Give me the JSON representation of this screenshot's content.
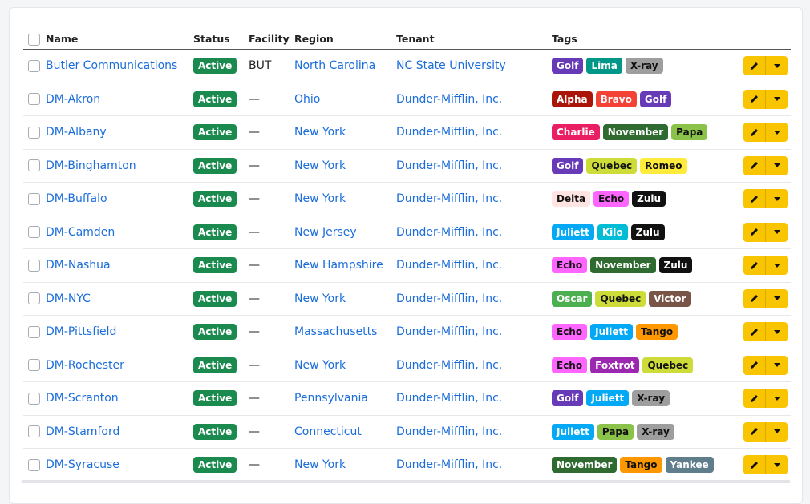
{
  "columns": {
    "name": "Name",
    "status": "Status",
    "facility": "Facility",
    "region": "Region",
    "tenant": "Tenant",
    "tags": "Tags"
  },
  "tag_colors": {
    "Golf": {
      "bg": "#673ab7",
      "fg": "#ffffff"
    },
    "Lima": {
      "bg": "#009688",
      "fg": "#ffffff"
    },
    "X-ray": {
      "bg": "#9e9e9e",
      "fg": "#111111"
    },
    "Alpha": {
      "bg": "#aa1409",
      "fg": "#ffffff"
    },
    "Bravo": {
      "bg": "#f44336",
      "fg": "#ffffff"
    },
    "Charlie": {
      "bg": "#e91e63",
      "fg": "#ffffff"
    },
    "November": {
      "bg": "#2f6a31",
      "fg": "#ffffff"
    },
    "Papa": {
      "bg": "#8bc34a",
      "fg": "#111111"
    },
    "Quebec": {
      "bg": "#cddc39",
      "fg": "#111111"
    },
    "Romeo": {
      "bg": "#ffeb3b",
      "fg": "#111111"
    },
    "Delta": {
      "bg": "#ffe4e1",
      "fg": "#111111"
    },
    "Echo": {
      "bg": "#ff66ff",
      "fg": "#111111"
    },
    "Zulu": {
      "bg": "#111111",
      "fg": "#ffffff"
    },
    "Juliett": {
      "bg": "#03a9f4",
      "fg": "#ffffff"
    },
    "Kilo": {
      "bg": "#00bcd4",
      "fg": "#ffffff"
    },
    "Oscar": {
      "bg": "#4caf50",
      "fg": "#ffffff"
    },
    "Victor": {
      "bg": "#795548",
      "fg": "#ffffff"
    },
    "Tango": {
      "bg": "#ff9800",
      "fg": "#111111"
    },
    "Foxtrot": {
      "bg": "#9c27b0",
      "fg": "#ffffff"
    },
    "Yankee": {
      "bg": "#607d8b",
      "fg": "#ffffff"
    }
  },
  "rows": [
    {
      "name": "Butler Communications",
      "status": "Active",
      "facility": "BUT",
      "region": "North Carolina",
      "tenant": "NC State University",
      "tags": [
        "Golf",
        "Lima",
        "X-ray"
      ]
    },
    {
      "name": "DM-Akron",
      "status": "Active",
      "facility": "—",
      "region": "Ohio",
      "tenant": "Dunder-Mifflin, Inc.",
      "tags": [
        "Alpha",
        "Bravo",
        "Golf"
      ]
    },
    {
      "name": "DM-Albany",
      "status": "Active",
      "facility": "—",
      "region": "New York",
      "tenant": "Dunder-Mifflin, Inc.",
      "tags": [
        "Charlie",
        "November",
        "Papa"
      ]
    },
    {
      "name": "DM-Binghamton",
      "status": "Active",
      "facility": "—",
      "region": "New York",
      "tenant": "Dunder-Mifflin, Inc.",
      "tags": [
        "Golf",
        "Quebec",
        "Romeo"
      ]
    },
    {
      "name": "DM-Buffalo",
      "status": "Active",
      "facility": "—",
      "region": "New York",
      "tenant": "Dunder-Mifflin, Inc.",
      "tags": [
        "Delta",
        "Echo",
        "Zulu"
      ]
    },
    {
      "name": "DM-Camden",
      "status": "Active",
      "facility": "—",
      "region": "New Jersey",
      "tenant": "Dunder-Mifflin, Inc.",
      "tags": [
        "Juliett",
        "Kilo",
        "Zulu"
      ]
    },
    {
      "name": "DM-Nashua",
      "status": "Active",
      "facility": "—",
      "region": "New Hampshire",
      "tenant": "Dunder-Mifflin, Inc.",
      "tags": [
        "Echo",
        "November",
        "Zulu"
      ]
    },
    {
      "name": "DM-NYC",
      "status": "Active",
      "facility": "—",
      "region": "New York",
      "tenant": "Dunder-Mifflin, Inc.",
      "tags": [
        "Oscar",
        "Quebec",
        "Victor"
      ]
    },
    {
      "name": "DM-Pittsfield",
      "status": "Active",
      "facility": "—",
      "region": "Massachusetts",
      "tenant": "Dunder-Mifflin, Inc.",
      "tags": [
        "Echo",
        "Juliett",
        "Tango"
      ]
    },
    {
      "name": "DM-Rochester",
      "status": "Active",
      "facility": "—",
      "region": "New York",
      "tenant": "Dunder-Mifflin, Inc.",
      "tags": [
        "Echo",
        "Foxtrot",
        "Quebec"
      ]
    },
    {
      "name": "DM-Scranton",
      "status": "Active",
      "facility": "—",
      "region": "Pennsylvania",
      "tenant": "Dunder-Mifflin, Inc.",
      "tags": [
        "Golf",
        "Juliett",
        "X-ray"
      ]
    },
    {
      "name": "DM-Stamford",
      "status": "Active",
      "facility": "—",
      "region": "Connecticut",
      "tenant": "Dunder-Mifflin, Inc.",
      "tags": [
        "Juliett",
        "Papa",
        "X-ray"
      ]
    },
    {
      "name": "DM-Syracuse",
      "status": "Active",
      "facility": "—",
      "region": "New York",
      "tenant": "Dunder-Mifflin, Inc.",
      "tags": [
        "November",
        "Tango",
        "Yankee"
      ]
    }
  ]
}
